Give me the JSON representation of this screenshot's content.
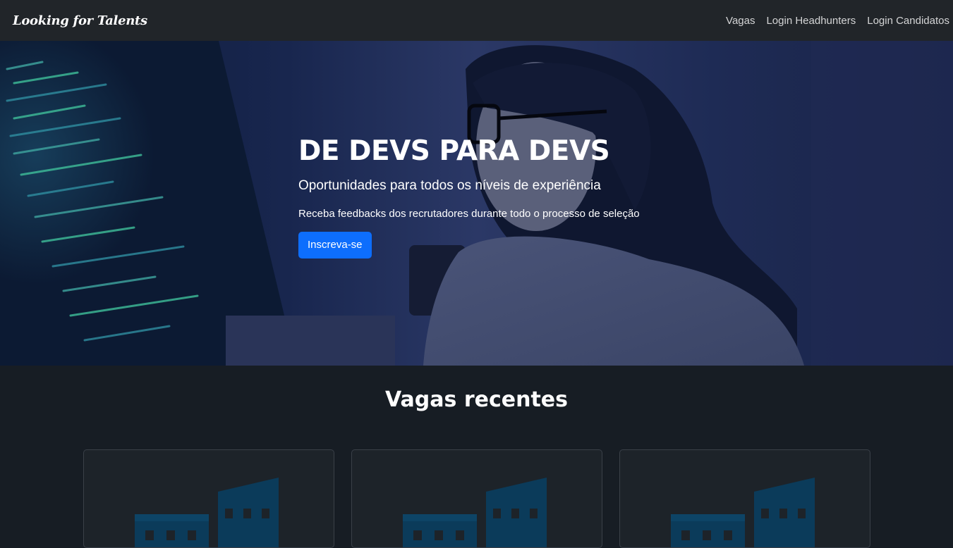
{
  "navbar": {
    "brand": "Looking for Talents",
    "links": [
      "Vagas",
      "Login Headhunters",
      "Login Candidatos"
    ]
  },
  "hero": {
    "title": "DE DEVS PARA DEVS",
    "subtitle": "Oportunidades para todos os níveis de experiência",
    "lead": "Receba feedbacks dos recrutadores durante todo o processo de seleção",
    "cta": "Inscreva-se"
  },
  "recent": {
    "title": "Vagas recentes",
    "cards": [
      {
        "icon": "building-icon"
      },
      {
        "icon": "building-icon"
      },
      {
        "icon": "building-icon"
      }
    ]
  },
  "colors": {
    "navbar_bg": "#212529",
    "page_bg": "#171d24",
    "primary": "#0d6efd",
    "building_icon": "#0b3b5a"
  }
}
